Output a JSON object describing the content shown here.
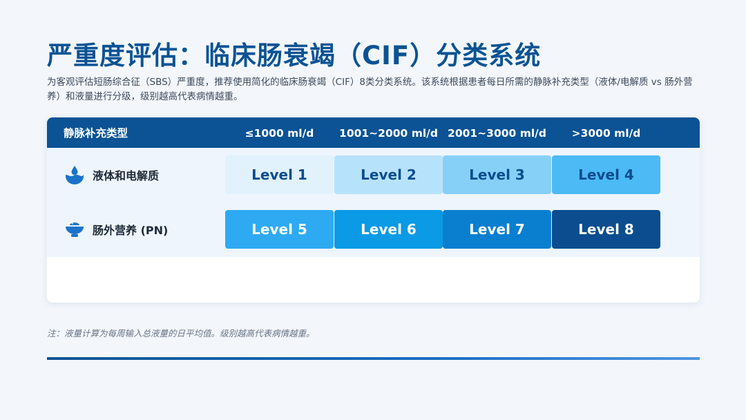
{
  "title": "严重度评估：临床肠衰竭（CIF）分类系统",
  "subtitle": "为客观评估短肠综合征（SBS）严重度，推荐使用简化的临床肠衰竭（CIF）8类分类系统。该系统根据患者每日所需的静脉补充类型（液体/电解质 vs 肠外营养）和液量进行分级，级别越高代表病情越重。",
  "table": {
    "header": {
      "type_label": "静脉补充类型",
      "volumes": [
        "≤1000 ml/d",
        "1001~2000 ml/d",
        "2001~3000 ml/d",
        ">3000 ml/d"
      ]
    },
    "rows": [
      {
        "label": "液体和电解质",
        "icon": "water-drop-icon",
        "levels": [
          "Level 1",
          "Level 2",
          "Level 3",
          "Level 4"
        ]
      },
      {
        "label": "肠外营养 (PN)",
        "icon": "nutrition-bowl-icon",
        "levels": [
          "Level 5",
          "Level 6",
          "Level 7",
          "Level 8"
        ]
      }
    ]
  },
  "note": "注：液量计算为每周输入总液量的日平均值。级别越高代表病情越重。",
  "colors": {
    "primary": "#0b5394",
    "level_1": "#e1f2fd",
    "level_2": "#b7e2fb",
    "level_3": "#86d0f8",
    "level_4": "#4cbaf5",
    "level_5": "#2eaaf2",
    "level_6": "#0a9ae6",
    "level_7": "#0a7fd0",
    "level_8": "#0b4d8e"
  }
}
